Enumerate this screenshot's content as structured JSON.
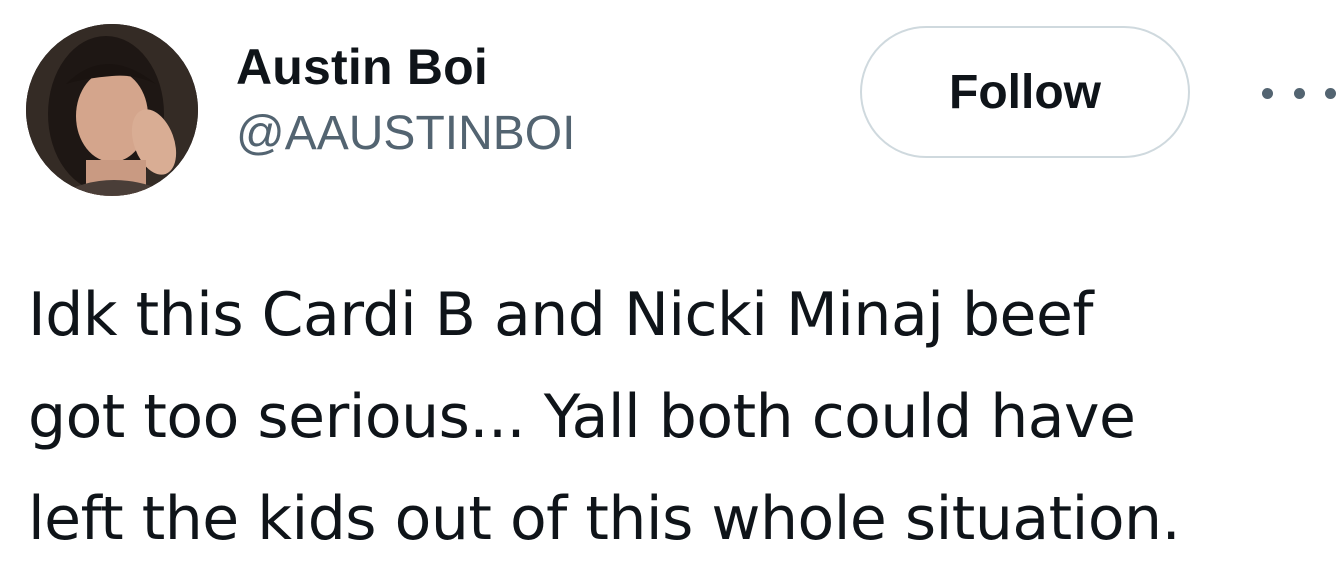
{
  "author": {
    "display_name": "Austin Boi",
    "handle": "@AAUSTINBOI",
    "avatar_icon": "profile-photo"
  },
  "actions": {
    "follow_label": "Follow",
    "more_icon": "more-horizontal-icon"
  },
  "tweet": {
    "lines": [
      "Idk this Cardi B and Nicki Minaj beef",
      "got too serious... Yall both could have",
      "left the kids out of this whole situation."
    ]
  },
  "colors": {
    "text_primary": "#0f1419",
    "text_secondary": "#536471",
    "button_border": "#cfd9de"
  }
}
